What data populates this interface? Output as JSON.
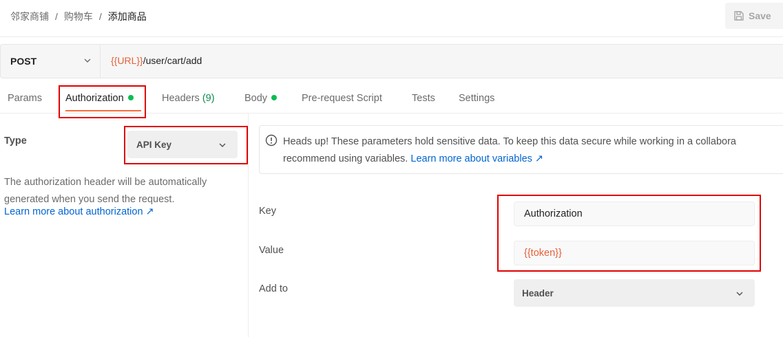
{
  "breadcrumb": {
    "items": [
      "邻家商铺",
      "购物车",
      "添加商品"
    ],
    "separator": "/"
  },
  "toolbar": {
    "save_label": "Save"
  },
  "request": {
    "method": "POST",
    "url_var": "{{URL}}",
    "url_path": "/user/cart/add"
  },
  "tabs": {
    "params": "Params",
    "authorization": "Authorization",
    "headers": "Headers",
    "headers_count": "(9)",
    "body": "Body",
    "prerequest": "Pre-request Script",
    "tests": "Tests",
    "settings": "Settings"
  },
  "auth": {
    "type_label": "Type",
    "type_value": "API Key",
    "description": "The authorization header will be automatically generated when you send the request.",
    "learn_more": "Learn more about authorization ↗"
  },
  "alert": {
    "line1": "Heads up! These parameters hold sensitive data. To keep this data secure while working in a collabora",
    "line2_prefix": "recommend using variables. ",
    "line2_link": "Learn more about variables ↗"
  },
  "fields": {
    "key_label": "Key",
    "key_value": "Authorization",
    "value_label": "Value",
    "value_value": "{{token}}",
    "addto_label": "Add to",
    "addto_value": "Header"
  },
  "colors": {
    "accent": "#ff6c37",
    "highlight": "#e00000",
    "variable": "#e5603a",
    "link": "#0265d2",
    "status_dot": "#0cbb52"
  }
}
